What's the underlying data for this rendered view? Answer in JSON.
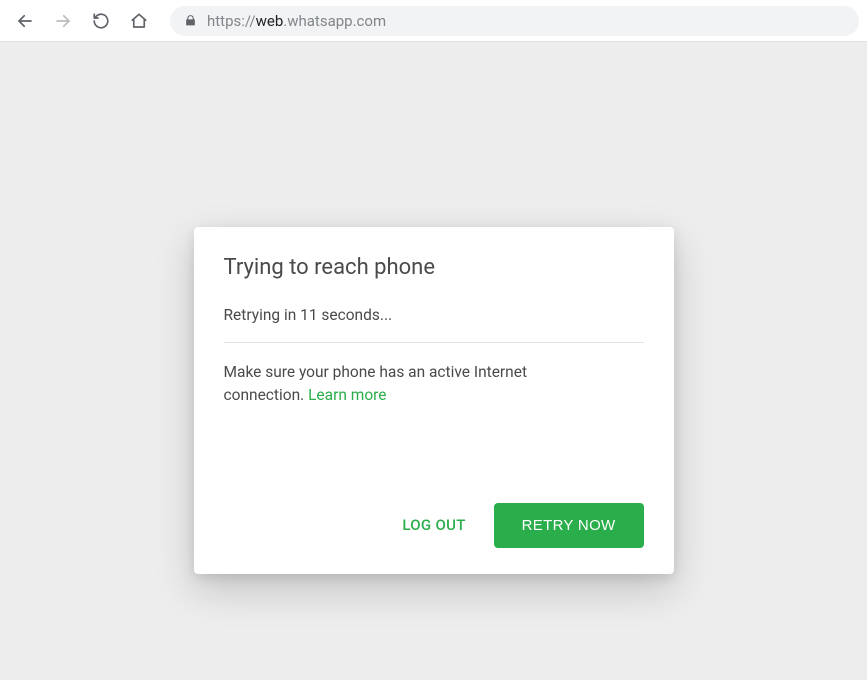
{
  "browser": {
    "url_prefix": "https://",
    "url_host": "web",
    "url_rest": ".whatsapp.com"
  },
  "dialog": {
    "title": "Trying to reach phone",
    "retry_message": "Retrying in 11 seconds...",
    "instruction_text": "Make sure your phone has an active Internet connection. ",
    "learn_more": "Learn more",
    "logout_label": "LOG OUT",
    "retry_now_label": "RETRY NOW"
  },
  "colors": {
    "accent": "#2aae4b",
    "page_bg": "#ededed"
  }
}
